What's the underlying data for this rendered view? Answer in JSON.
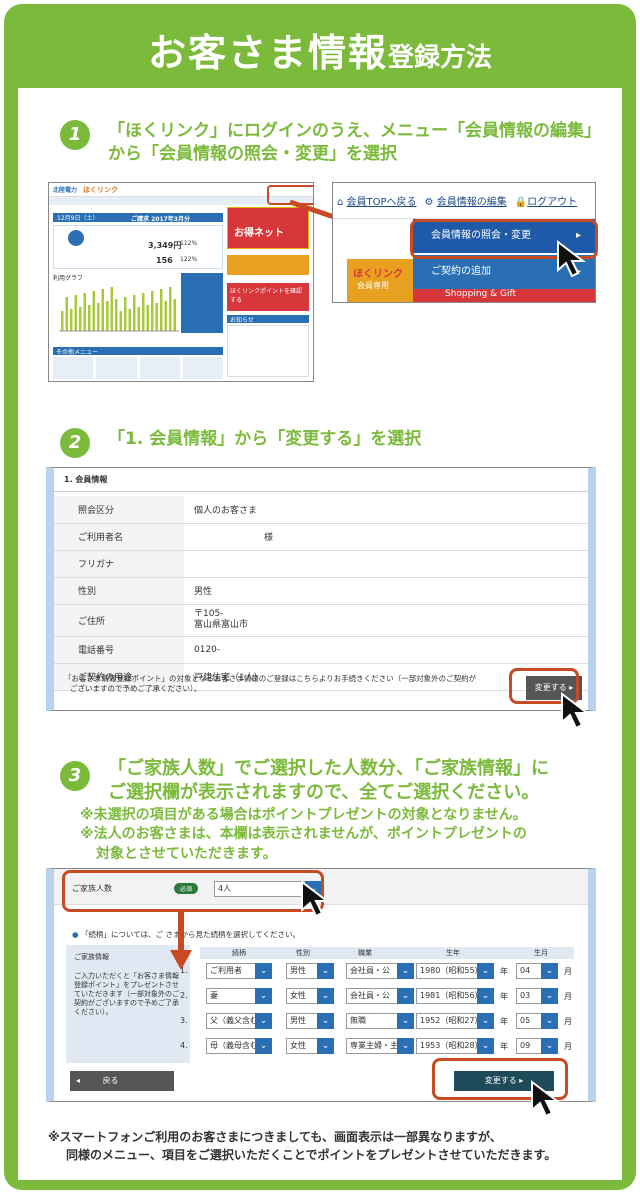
{
  "title": {
    "main": "お客さま情報",
    "sub": "登録方法"
  },
  "steps": [
    {
      "num": "1",
      "line1": "「ほくリンク」にログインのうえ、メニュー「会員情報の編集」",
      "line2": "から「会員情報の照会・変更」を選択"
    },
    {
      "num": "2",
      "line1": "「1. 会員情報」から「変更する」を選択"
    },
    {
      "num": "3",
      "line1": "「ご家族人数」でご選択した人数分、「ご家族情報」に",
      "line2": "ご選択欄が表示されますので、全てご選択ください。"
    }
  ],
  "notes": {
    "n1": "※未選択の項目がある場合はポイントプレゼントの対象となりません。",
    "n2": "※法人のお客さまは、本欄は表示されませんが、ポイントプレゼントの",
    "n3": "対象とさせていただきます。"
  },
  "shot1": {
    "logo": "北陸電力",
    "brand": "ほくリンク",
    "date": "12月9日（土）",
    "month": "ご請求 2017年3月分",
    "amount": "3,349",
    "unit": "円",
    "kwh": "156",
    "graph": "利用グラフ",
    "other": "その他メニュー",
    "banner1": "お得ネット",
    "banner2": "ほくリンクポイントを確認する",
    "news": "お知らせ",
    "pct": "112%",
    "pct2": "122%"
  },
  "shot1b": {
    "top": "会員TOPへ戻る",
    "edit": "会員情報の編集",
    "logout": "ログアウト",
    "menu1": "会員情報の照会・変更",
    "menu2": "ご契約の追加",
    "brand": "ほくリンク",
    "brand_sub": "会員専用",
    "shop": "Shopping & Gift"
  },
  "shot2": {
    "section": "1. 会員情報",
    "rows": [
      {
        "k": "照会区分",
        "v": "個人のお客さま"
      },
      {
        "k": "ご利用者名",
        "v": "様"
      },
      {
        "k": "フリガナ",
        "v": ""
      },
      {
        "k": "性別",
        "v": "男性"
      },
      {
        "k": "ご住所",
        "v": "〒105-"
      },
      {
        "k": "電話番号",
        "v": "0120-"
      },
      {
        "k": "ご契約の用途",
        "v": "戸建住宅（1人）"
      }
    ],
    "addr2": "富山県富山市",
    "note1": "「お客さま情報登録ポイント」の対象となるお客さま情報のご登録はこちらよりお手続きください（一部対象外のご契約が",
    "note2": "ございますので予めご了承ください）。",
    "btn": "変更する"
  },
  "shot3": {
    "family_label": "ご家族人数",
    "required": "必須",
    "family_value": "4人",
    "info": "「続柄」については、ご                  さまから見た続柄を選択してください。",
    "side_title": "ご家族情報",
    "side_text": "ご入力いただくと「お客さま情報登録ポイント」をプレゼントさせていただきます（一部対象外のご契約がございますので予めご了承ください）。",
    "headers": [
      "続柄",
      "性別",
      "職業",
      "生年",
      "生月"
    ],
    "rows": [
      {
        "n": "1.",
        "rel": "ご利用者",
        "sex": "男性",
        "job": "会社員・公",
        "year": "1980（昭和55）",
        "month": "04"
      },
      {
        "n": "2.",
        "rel": "妻",
        "sex": "女性",
        "job": "会社員・公",
        "year": "1981（昭和56）",
        "month": "03"
      },
      {
        "n": "3.",
        "rel": "父（義父含む",
        "sex": "男性",
        "job": "無職",
        "year": "1952（昭和27）",
        "month": "05"
      },
      {
        "n": "4.",
        "rel": "母（義母含む",
        "sex": "女性",
        "job": "専業主婦・主",
        "year": "1953（昭和28）",
        "month": "09"
      }
    ],
    "year_suffix": "年",
    "month_suffix": "月",
    "back": "戻る",
    "submit": "変更する"
  },
  "footer": {
    "l1": "※スマートフォンご利用のお客さまにつきましても、画面表示は一部異なりますが、",
    "l2": "同様のメニュー、項目をご選択いただくことでポイントをプレゼントさせていただきます。"
  },
  "colors": {
    "green": "#7bba3b",
    "red": "#c84a22",
    "blue": "#2a6fb3"
  }
}
